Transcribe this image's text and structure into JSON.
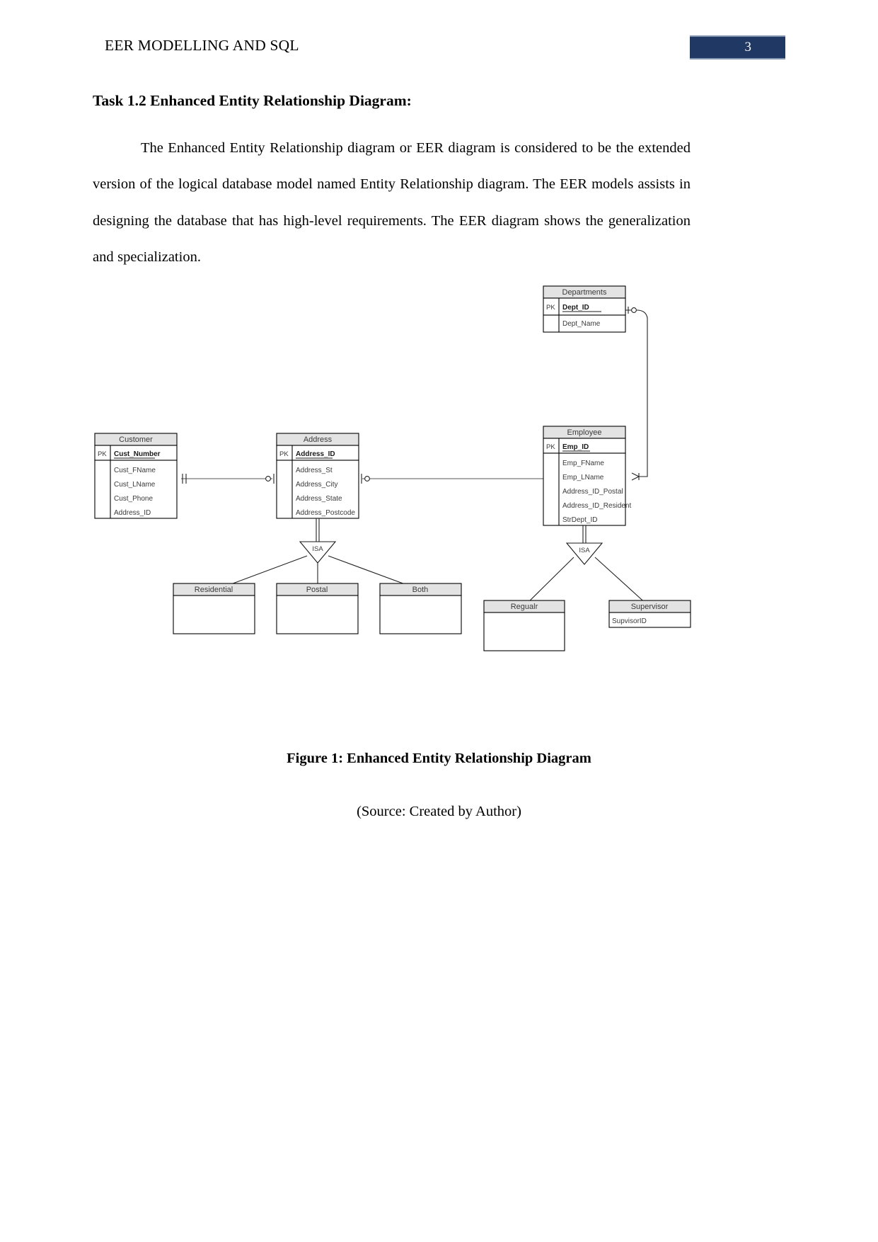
{
  "header": {
    "title": "EER MODELLING AND SQL",
    "page_number": "3",
    "badge_color": "#1f3864",
    "badge_border_color": "#8496b0"
  },
  "content": {
    "section_heading": "Task 1.2 Enhanced Entity Relationship Diagram:",
    "paragraph": "The Enhanced Entity Relationship diagram or EER diagram is considered to be the extended version of the logical database model named Entity Relationship diagram. The EER models assists in designing the database that has high-level requirements. The EER diagram shows the generalization and specialization."
  },
  "figure": {
    "caption": "Figure 1: Enhanced Entity Relationship Diagram",
    "source": "(Source: Created by Author)"
  },
  "diagram": {
    "pk_label": "PK",
    "isa_label": "ISA",
    "entities": [
      {
        "id": "departments",
        "name": "Departments",
        "key": "Dept_ID",
        "attributes": [
          "Dept_Name"
        ]
      },
      {
        "id": "customer",
        "name": "Customer",
        "key": "Cust_Number",
        "attributes": [
          "Cust_FName",
          "Cust_LName",
          "Cust_Phone",
          "Address_ID"
        ]
      },
      {
        "id": "address",
        "name": "Address",
        "key": "Address_ID",
        "attributes": [
          "Address_St",
          "Address_City",
          "Address_State",
          "Address_Postcode"
        ]
      },
      {
        "id": "employee",
        "name": "Employee",
        "key": "Emp_ID",
        "attributes": [
          "Emp_FName",
          "Emp_LName",
          "Address_ID_Postal",
          "Address_ID_Resident",
          "StrDept_ID"
        ]
      }
    ],
    "subtypes": [
      {
        "id": "residential",
        "name": "Residential",
        "attributes": []
      },
      {
        "id": "postal",
        "name": "Postal",
        "attributes": []
      },
      {
        "id": "both",
        "name": "Both",
        "attributes": []
      },
      {
        "id": "regualr",
        "name": "Regualr",
        "attributes": []
      },
      {
        "id": "supervisor",
        "name": "Supervisor",
        "attributes": [
          "SupvisorID"
        ]
      }
    ],
    "relationships": [
      {
        "from": "customer",
        "to": "address",
        "from_card": "one-mandatory",
        "to_card": "zero-or-one"
      },
      {
        "from": "address",
        "to": "employee",
        "from_card": "zero-or-one",
        "to_card": "many"
      },
      {
        "from": "departments",
        "to": "employee",
        "from_card": "zero-or-one",
        "to_card": "many"
      }
    ],
    "generalizations": [
      {
        "parent": "address",
        "children": [
          "residential",
          "postal",
          "both"
        ]
      },
      {
        "parent": "employee",
        "children": [
          "regualr",
          "supervisor"
        ]
      }
    ]
  }
}
